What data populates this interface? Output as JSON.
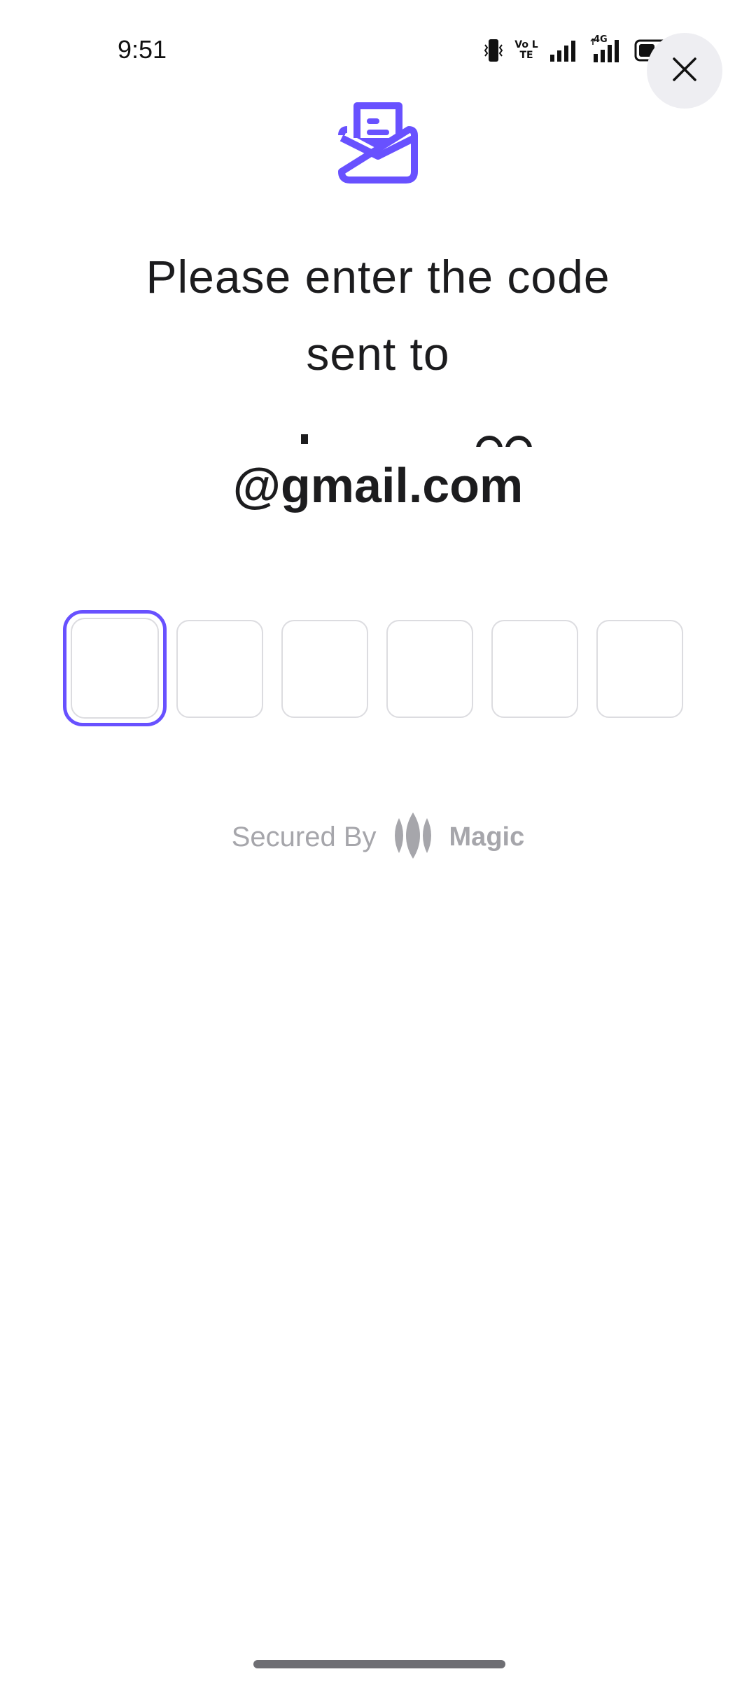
{
  "status_bar": {
    "time": "9:51",
    "volte_label": "Vo LTE",
    "network_label": "4G",
    "icons": [
      "vibrate-icon",
      "volte-icon",
      "signal-icon",
      "4g-signal-icon",
      "battery-icon"
    ]
  },
  "close_button": {
    "icon": "close-icon"
  },
  "header_icon": "mail-icon",
  "heading": {
    "line1": "Please enter the code",
    "line2": "sent to",
    "email_domain": "@gmail.com"
  },
  "otp": {
    "length": 6,
    "values": [
      "",
      "",
      "",
      "",
      "",
      ""
    ],
    "active_index": 0
  },
  "footer": {
    "secured_label": "Secured By",
    "brand_name": "Magic",
    "brand_icon": "magic-logo-icon"
  },
  "colors": {
    "accent": "#6851ff",
    "muted_text": "#a6a6ab",
    "box_border": "#dcdce0",
    "close_bg": "#eeeef2"
  }
}
